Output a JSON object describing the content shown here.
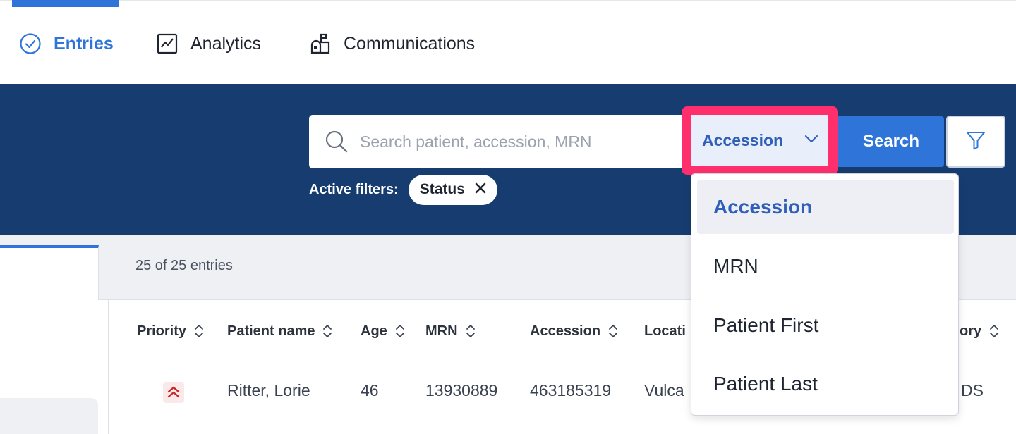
{
  "nav": {
    "tabs": [
      {
        "label": "Entries",
        "icon": "check-circle-icon",
        "active": true
      },
      {
        "label": "Analytics",
        "icon": "chart-line-icon",
        "active": false
      },
      {
        "label": "Communications",
        "icon": "mailbox-icon",
        "active": false
      }
    ]
  },
  "search": {
    "placeholder": "Search patient, accession, MRN",
    "field_selected": "Accession",
    "button_label": "Search",
    "filter_icon": "filter-icon"
  },
  "active_filters": {
    "label": "Active filters:",
    "chips": [
      {
        "label": "Status",
        "remove_icon": "close-icon"
      }
    ]
  },
  "entries": {
    "count_text": "25 of 25 entries"
  },
  "table": {
    "columns": [
      "Priority",
      "Patient name",
      "Age",
      "MRN",
      "Accession",
      "Locati",
      "ory"
    ],
    "rows": [
      {
        "priority_icon": "double-chevron-up-icon",
        "patient_name": "Ritter, Lorie",
        "age": "46",
        "mrn": "13930889",
        "accession": "463185319",
        "location": "Vulca",
        "category": "DS"
      }
    ]
  },
  "dropdown": {
    "options": [
      "Accession",
      "MRN",
      "Patient First",
      "Patient Last"
    ],
    "selected": "Accession"
  },
  "colors": {
    "accent": "#2f74d8",
    "band": "#173d70",
    "highlight": "#ff2f6e",
    "priority_high": "#c62828"
  }
}
